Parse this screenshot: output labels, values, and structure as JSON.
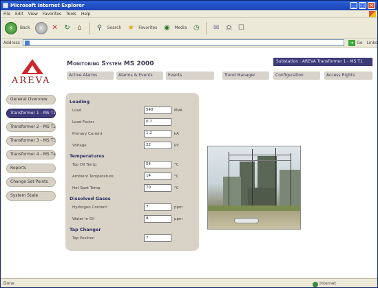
{
  "window": {
    "title": "Microsoft Internet Explorer",
    "buttons": {
      "minimize": "_",
      "maximize": "□",
      "close": "×"
    }
  },
  "menubar": [
    "File",
    "Edit",
    "View",
    "Favorites",
    "Tools",
    "Help"
  ],
  "toolbar": {
    "back_label": "Back",
    "search_label": "Search",
    "favorites_label": "Favorites",
    "media_label": "Media"
  },
  "addressbar": {
    "label": "Address",
    "value": "",
    "go_label": "Go",
    "links_label": "Links"
  },
  "page": {
    "brand": "AREVA",
    "app_title": "Monitoring System MS 2000",
    "unit_selector": "Substation : AREVA Transformer 1 - MS T1",
    "topnav": [
      "Active Alarms",
      "Alarms & Events",
      "Events",
      "Trend Manager",
      "Configuration",
      "Access Rights"
    ],
    "sidenav": [
      {
        "label": "General Overview",
        "active": false
      },
      {
        "label": "Transformer 1 - MS T1",
        "active": true
      },
      {
        "label": "Transformer 2 - MS T2",
        "active": false
      },
      {
        "label": "Transformer 3 - MS T3",
        "active": false
      },
      {
        "label": "Transformer 4 - MS T4",
        "active": false
      },
      {
        "label": "Reports",
        "active": false
      },
      {
        "label": "Change Set Points",
        "active": false
      },
      {
        "label": "System State",
        "active": false
      }
    ],
    "sections": [
      {
        "title": "Loading",
        "rows": [
          {
            "label": "Load",
            "value": "540",
            "unit": "MVA"
          },
          {
            "label": "Load Factor",
            "value": "0.7",
            "unit": ""
          },
          {
            "label": "Primary Current",
            "value": "1.2",
            "unit": "kA"
          },
          {
            "label": "Voltage",
            "value": "22",
            "unit": "kV"
          }
        ]
      },
      {
        "title": "Temperatures",
        "rows": [
          {
            "label": "Top Oil Temp.",
            "value": "54",
            "unit": "°C"
          },
          {
            "label": "Ambient Temperature",
            "value": "14",
            "unit": "°C"
          },
          {
            "label": "Hot Spot Temp.",
            "value": "70",
            "unit": "°C"
          }
        ]
      },
      {
        "title": "Dissolved Gases",
        "rows": [
          {
            "label": "Hydrogen Content",
            "value": "7",
            "unit": "ppm"
          },
          {
            "label": "Water in Oil",
            "value": "8",
            "unit": "ppm"
          }
        ]
      },
      {
        "title": "Tap Changer",
        "rows": [
          {
            "label": "Tap Position",
            "value": "7",
            "unit": ""
          }
        ]
      }
    ]
  },
  "statusbar": {
    "left": "Done",
    "zone": "Internet"
  }
}
